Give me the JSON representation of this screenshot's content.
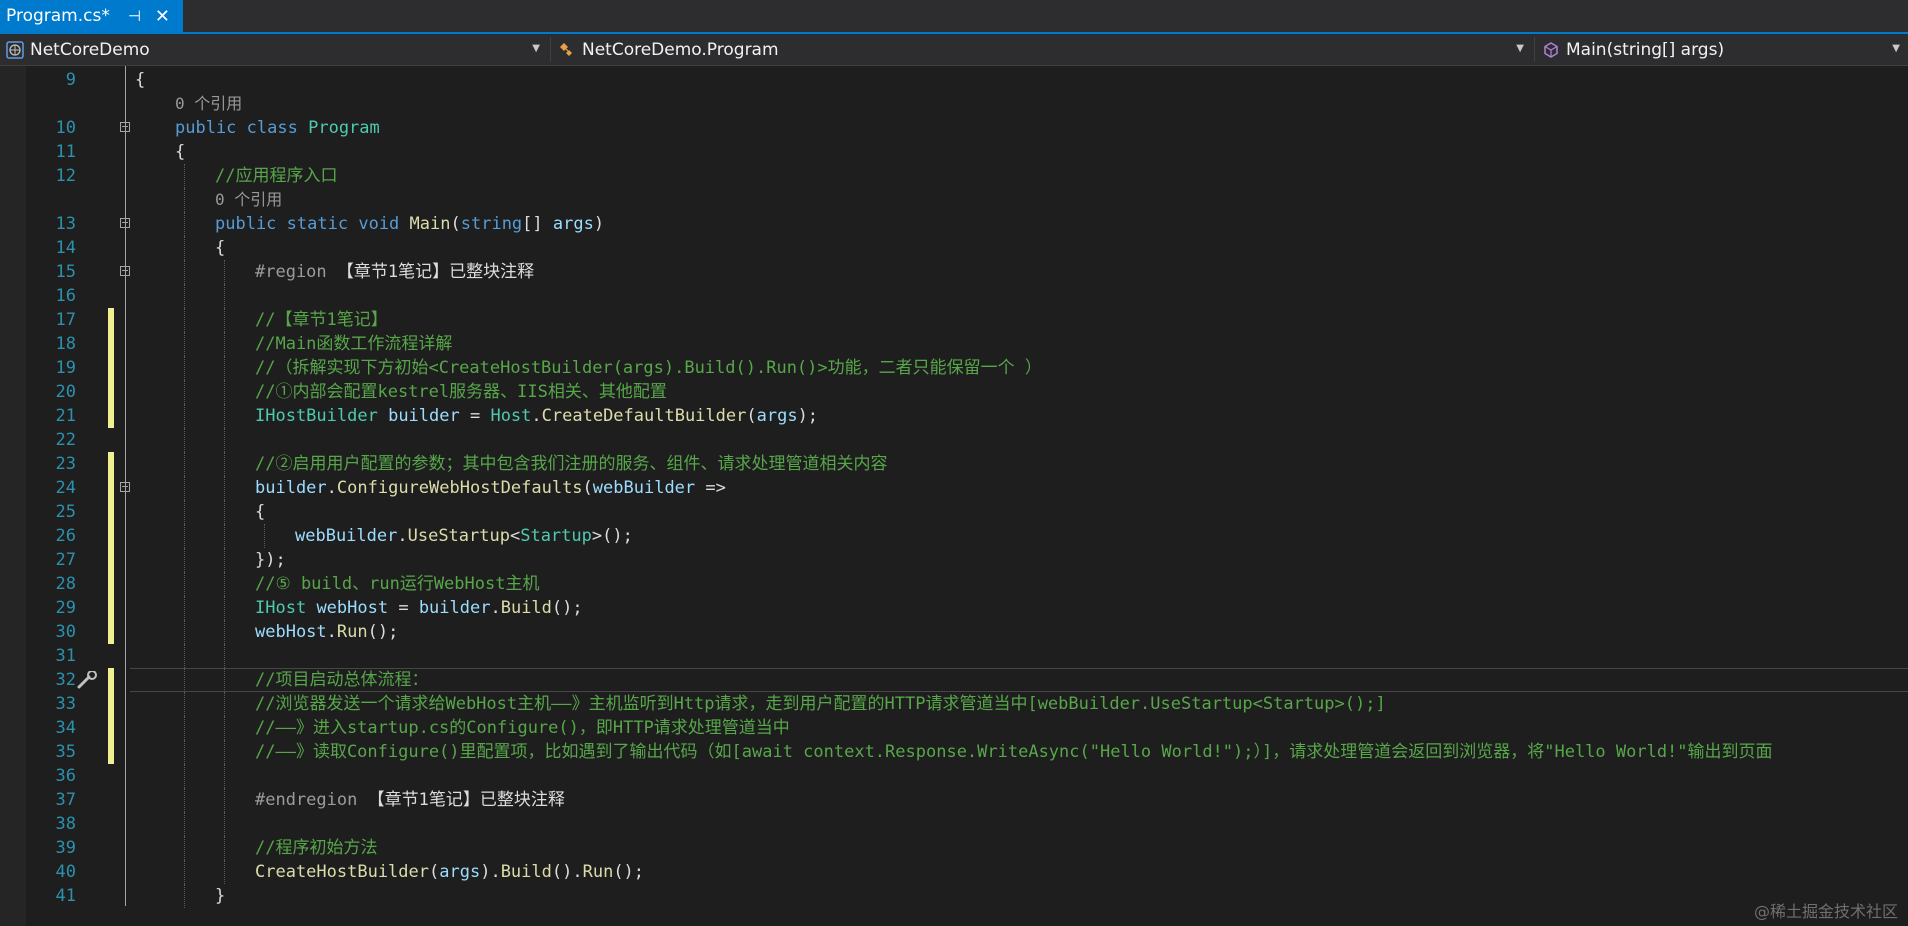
{
  "tab": {
    "label": "Program.cs*",
    "pin_glyph": "⊣",
    "close_glyph": "✕"
  },
  "navbar": {
    "project": "NetCoreDemo",
    "type": "NetCoreDemo.Program",
    "member": "Main(string[] args)"
  },
  "watermark": "@稀土掘金技术社区",
  "colors": {
    "keyword": "#569cd6",
    "type": "#4ec9b0",
    "method": "#dcdcaa",
    "variable": "#9cdcfe",
    "comment": "#57a64a",
    "line_number": "#2b91af",
    "change_marker": "#efef91",
    "tab_active": "#007acc"
  },
  "lines": [
    {
      "num": "9",
      "tokens": [
        [
          "p",
          "{"
        ]
      ]
    },
    {
      "num": "",
      "lens": "0 个引用",
      "indent": 1
    },
    {
      "num": "10",
      "fold": true,
      "indent": 1,
      "tokens": [
        [
          "kw",
          "public"
        ],
        [
          "p",
          " "
        ],
        [
          "kw",
          "class"
        ],
        [
          "p",
          " "
        ],
        [
          "ty",
          "Program"
        ]
      ]
    },
    {
      "num": "11",
      "indent": 1,
      "tokens": [
        [
          "p",
          "{"
        ]
      ]
    },
    {
      "num": "12",
      "indent": 2,
      "tokens": [
        [
          "cm",
          "//应用程序入口"
        ]
      ]
    },
    {
      "num": "",
      "lens": "0 个引用",
      "indent": 2
    },
    {
      "num": "13",
      "fold": true,
      "indent": 2,
      "tokens": [
        [
          "kw",
          "public"
        ],
        [
          "p",
          " "
        ],
        [
          "kw",
          "static"
        ],
        [
          "p",
          " "
        ],
        [
          "kw",
          "void"
        ],
        [
          "p",
          " "
        ],
        [
          "fn",
          "Main"
        ],
        [
          "p",
          "("
        ],
        [
          "kw",
          "string"
        ],
        [
          "p",
          "[] "
        ],
        [
          "vr",
          "args"
        ],
        [
          "p",
          ")"
        ]
      ]
    },
    {
      "num": "14",
      "indent": 2,
      "tokens": [
        [
          "p",
          "{"
        ]
      ]
    },
    {
      "num": "15",
      "fold": true,
      "indent": 3,
      "tokens": [
        [
          "pp",
          "#region "
        ],
        [
          "rg",
          "【章节1笔记】已整块注释"
        ]
      ]
    },
    {
      "num": "16",
      "indent": 3,
      "tokens": []
    },
    {
      "num": "17",
      "chg": true,
      "indent": 3,
      "tokens": [
        [
          "cm",
          "//【章节1笔记】"
        ]
      ]
    },
    {
      "num": "18",
      "chg": true,
      "indent": 3,
      "tokens": [
        [
          "cm",
          "//Main函数工作流程详解"
        ]
      ]
    },
    {
      "num": "19",
      "chg": true,
      "indent": 3,
      "tokens": [
        [
          "cm",
          "//（拆解实现下方初始<CreateHostBuilder(args).Build().Run()>功能，二者只能保留一个 ）"
        ]
      ]
    },
    {
      "num": "20",
      "chg": true,
      "indent": 3,
      "tokens": [
        [
          "cm",
          "//①内部会配置kestrel服务器、IIS相关、其他配置"
        ]
      ]
    },
    {
      "num": "21",
      "chg": true,
      "indent": 3,
      "tokens": [
        [
          "ty",
          "IHostBuilder"
        ],
        [
          "p",
          " "
        ],
        [
          "vr",
          "builder"
        ],
        [
          "p",
          " = "
        ],
        [
          "ty",
          "Host"
        ],
        [
          "p",
          "."
        ],
        [
          "fn",
          "CreateDefaultBuilder"
        ],
        [
          "p",
          "("
        ],
        [
          "vr",
          "args"
        ],
        [
          "p",
          ");"
        ]
      ]
    },
    {
      "num": "22",
      "indent": 3,
      "tokens": []
    },
    {
      "num": "23",
      "chg": true,
      "indent": 3,
      "tokens": [
        [
          "cm",
          "//②启用用户配置的参数；其中包含我们注册的服务、组件、请求处理管道相关内容"
        ]
      ]
    },
    {
      "num": "24",
      "chg": true,
      "fold": true,
      "indent": 3,
      "tokens": [
        [
          "vr",
          "builder"
        ],
        [
          "p",
          "."
        ],
        [
          "fn",
          "ConfigureWebHostDefaults"
        ],
        [
          "p",
          "("
        ],
        [
          "vr",
          "webBuilder"
        ],
        [
          "p",
          " =>"
        ]
      ]
    },
    {
      "num": "25",
      "chg": true,
      "indent": 3,
      "tokens": [
        [
          "p",
          "{"
        ]
      ]
    },
    {
      "num": "26",
      "chg": true,
      "indent": 4,
      "tokens": [
        [
          "vr",
          "webBuilder"
        ],
        [
          "p",
          "."
        ],
        [
          "fn",
          "UseStartup"
        ],
        [
          "p",
          "<"
        ],
        [
          "ty",
          "Startup"
        ],
        [
          "p",
          ">();"
        ]
      ]
    },
    {
      "num": "27",
      "chg": true,
      "indent": 3,
      "tokens": [
        [
          "p",
          "});"
        ]
      ]
    },
    {
      "num": "28",
      "chg": true,
      "indent": 3,
      "tokens": [
        [
          "cm",
          "//⑤ build、run运行WebHost主机"
        ]
      ]
    },
    {
      "num": "29",
      "chg": true,
      "indent": 3,
      "tokens": [
        [
          "ty",
          "IHost"
        ],
        [
          "p",
          " "
        ],
        [
          "vr",
          "webHost"
        ],
        [
          "p",
          " = "
        ],
        [
          "vr",
          "builder"
        ],
        [
          "p",
          "."
        ],
        [
          "fn",
          "Build"
        ],
        [
          "p",
          "();"
        ]
      ]
    },
    {
      "num": "30",
      "chg": true,
      "indent": 3,
      "tokens": [
        [
          "vr",
          "webHost"
        ],
        [
          "p",
          "."
        ],
        [
          "fn",
          "Run"
        ],
        [
          "p",
          "();"
        ]
      ]
    },
    {
      "num": "31",
      "indent": 3,
      "tokens": []
    },
    {
      "num": "32",
      "chg": true,
      "current": true,
      "wrench": true,
      "indent": 3,
      "tokens": [
        [
          "cm",
          "//项目启动总体流程："
        ]
      ]
    },
    {
      "num": "33",
      "chg": true,
      "indent": 3,
      "tokens": [
        [
          "cm",
          "//浏览器发送一个请求给WebHost主机——》主机监听到Http请求，走到用户配置的HTTP请求管道当中[webBuilder.UseStartup<Startup>();]"
        ]
      ]
    },
    {
      "num": "34",
      "chg": true,
      "indent": 3,
      "tokens": [
        [
          "cm",
          "//——》进入startup.cs的Configure()，即HTTP请求处理管道当中"
        ]
      ]
    },
    {
      "num": "35",
      "chg": true,
      "indent": 3,
      "tokens": [
        [
          "cm",
          "//——》读取Configure()里配置项，比如遇到了输出代码（如[await context.Response.WriteAsync(\"Hello World!\");）]，请求处理管道会返回到浏览器，将\"Hello World!\"输出到页面"
        ]
      ]
    },
    {
      "num": "36",
      "indent": 3,
      "tokens": []
    },
    {
      "num": "37",
      "indent": 3,
      "tokens": [
        [
          "pp",
          "#endregion "
        ],
        [
          "rg",
          "【章节1笔记】已整块注释"
        ]
      ]
    },
    {
      "num": "38",
      "indent": 3,
      "tokens": []
    },
    {
      "num": "39",
      "indent": 3,
      "tokens": [
        [
          "cm",
          "//程序初始方法"
        ]
      ]
    },
    {
      "num": "40",
      "indent": 3,
      "tokens": [
        [
          "fn",
          "CreateHostBuilder"
        ],
        [
          "p",
          "("
        ],
        [
          "vr",
          "args"
        ],
        [
          "p",
          ")."
        ],
        [
          "fn",
          "Build"
        ],
        [
          "p",
          "()."
        ],
        [
          "fn",
          "Run"
        ],
        [
          "p",
          "();"
        ]
      ]
    },
    {
      "num": "41",
      "indent": 2,
      "tokens": [
        [
          "p",
          "}"
        ]
      ]
    }
  ]
}
